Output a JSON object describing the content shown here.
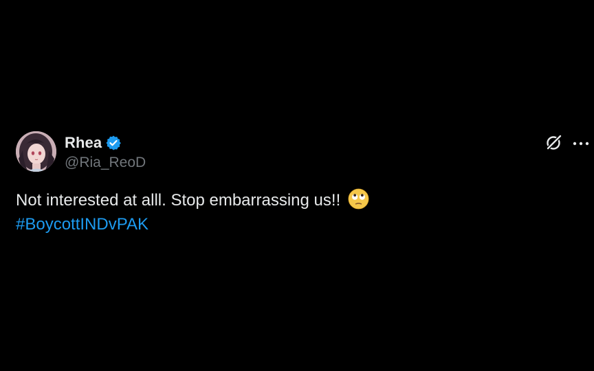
{
  "tweet": {
    "author": {
      "display_name": "Rhea",
      "handle": "@Ria_ReoD",
      "verified": true,
      "avatar_icon": "avatar-anime-girl"
    },
    "text": "Not interested at alll. Stop embarrassing us!!",
    "emoji": "face-with-rolling-eyes",
    "hashtag": "#BoycottINDvPAK",
    "actions": {
      "grok_icon": "grok-icon",
      "more_icon": "more-icon"
    }
  },
  "colors": {
    "background": "#000000",
    "primary_text": "#e7e9ea",
    "secondary_text": "#71767b",
    "accent": "#1d9bf0"
  }
}
